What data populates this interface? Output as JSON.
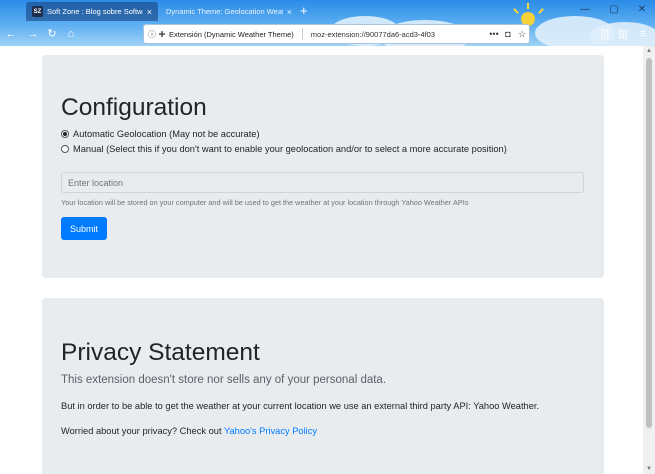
{
  "browser": {
    "tabs": [
      {
        "favicon": "SZ",
        "title": "Soft Zone : Blog sobre Software",
        "close": "×"
      },
      {
        "title": "Dynamic Theme: Geolocation Weather",
        "close": "×"
      }
    ],
    "new_tab": "+",
    "window_controls": {
      "minimize": "—",
      "maximize": "▢",
      "close": "✕"
    },
    "nav": {
      "back": "←",
      "forward": "→",
      "reload": "↻",
      "home": "⌂"
    },
    "url_identity": "Extensión (Dynamic Weather Theme)",
    "url": "moz-extension://90077da6-acd3-4f03",
    "actions": {
      "more": "•••",
      "pocket": "◘",
      "bookmark": "☆"
    },
    "toolbar": {
      "library": "|||",
      "sidebar": "▥",
      "menu": "≡"
    }
  },
  "config": {
    "title": "Configuration",
    "option_auto": "Automatic Geolocation (May not be accurate)",
    "option_manual": "Manual (Select this if you don't want to enable your geolocation and/or to select a more accurate position)",
    "selected": "auto",
    "location_placeholder": "Enter location",
    "location_value": "",
    "help_text": "Your location will be stored on your computer and will be used to get the weather at your location through Yahoo Weather APIs",
    "submit_label": "Submit"
  },
  "privacy": {
    "title": "Privacy Statement",
    "lead": "This extension doesn't store nor sells any of your personal data.",
    "paragraph": "But in order to be able to get the weather at your current location we use an external third party API: Yahoo Weather.",
    "worried": "Worried about your privacy? Check out",
    "link": "Yahoo's Privacy Policy"
  },
  "colors": {
    "primary": "#007bff",
    "jumbotron": "#e9ecef",
    "muted": "#6c757d",
    "chrome_top": "#2b8be6"
  }
}
